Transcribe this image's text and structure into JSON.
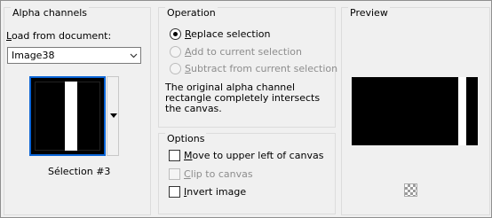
{
  "alpha_channels": {
    "title": "Alpha channels",
    "load_label": "Load from document:",
    "document_selected": "Image38",
    "selection_caption": "Sélection #3"
  },
  "operation": {
    "title": "Operation",
    "options": [
      {
        "label": "Replace selection",
        "selected": true,
        "enabled": true
      },
      {
        "label": "Add to current selection",
        "selected": false,
        "enabled": false
      },
      {
        "label": "Subtract from current selection",
        "selected": false,
        "enabled": false
      }
    ],
    "description": "The original alpha channel rectangle completely intersects the canvas."
  },
  "options": {
    "title": "Options",
    "items": [
      {
        "label": "Move to upper left of canvas",
        "checked": false,
        "enabled": true
      },
      {
        "label": "Clip to canvas",
        "checked": false,
        "enabled": false
      },
      {
        "label": "Invert image",
        "checked": false,
        "enabled": true
      }
    ]
  },
  "preview": {
    "title": "Preview",
    "transparency_icon": "checkerboard-icon"
  },
  "icons": {
    "dropdown": "chevron-down-icon",
    "thumb_dropdown": "triangle-down-icon"
  },
  "colors": {
    "selection_border": "#0a64d6",
    "frame": "#8f8f8f"
  }
}
